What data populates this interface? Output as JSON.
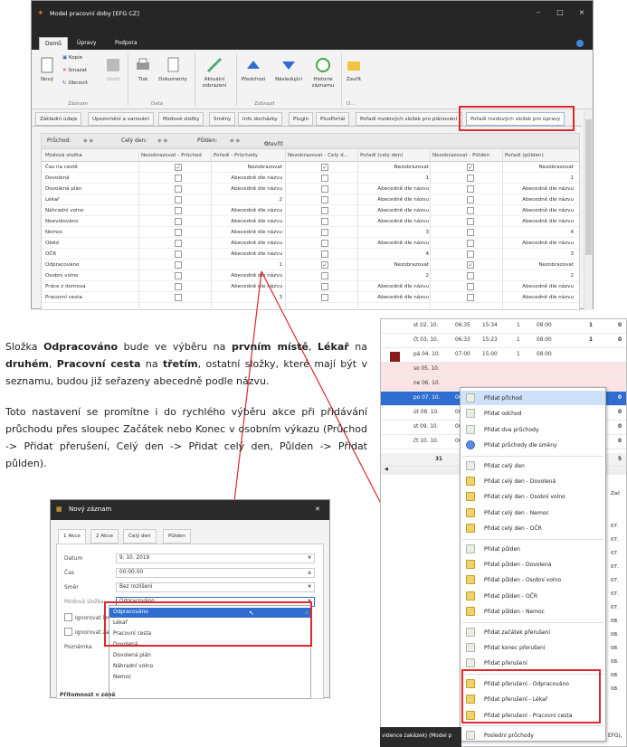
{
  "window": {
    "title": "Model pracovní doby [EFG CZ]",
    "controls": [
      "–",
      "□",
      "×"
    ]
  },
  "ribbon_tabs": [
    "Domů",
    "Úpravy",
    "Podpora"
  ],
  "ribbon": {
    "buttons": {
      "new": "Nový",
      "copy": "Kopie",
      "delete": "Smazat",
      "refresh": "Obnovit",
      "save": "Uložit",
      "print": "Tisk",
      "documents": "Dokumenty",
      "current_view": "Aktuální zobrazení",
      "previous": "Předchozí",
      "next": "Následující",
      "history": "Historie záznamu",
      "close": "Zavřít"
    },
    "groups": [
      "Záznam",
      "Data",
      "Zobrazit",
      "O..."
    ]
  },
  "doc_tabs": [
    "Základní údaje",
    "Upozornění a varování",
    "Mzdové složky",
    "Směny",
    "Info docházky",
    "Plugin",
    "PlusPortál",
    "Pořadí mzdových složek pro plánování",
    "Pořadí mzdových složek pro úpravy"
  ],
  "filter": {
    "pruchod": "Průchod:",
    "cely_den": "Celý den:",
    "pulden": "Půlden:",
    "otevrit": "Otevřít"
  },
  "grid": {
    "headers": [
      "Mzdová složka",
      "Nezobrazovat - Průchod",
      "Pořadí - Průchody",
      "Nezobrazovat - Celý d...",
      "Pořadí (celý den)",
      "Nezobrazovat - Půlden",
      "Pořadí (půlden)"
    ],
    "rows": [
      {
        "name": "Čas na cestě",
        "c1": true,
        "p1": "Nezobrazovat",
        "c2": true,
        "p2": "Nezobrazovat",
        "c3": true,
        "p3": "Nezobrazovat"
      },
      {
        "name": "Dovolená",
        "c1": false,
        "p1": "Abecedně dle názvu",
        "c2": false,
        "p2": "1",
        "c3": false,
        "p3": "1"
      },
      {
        "name": "Dovolená plán",
        "c1": false,
        "p1": "Abecedně dle názvu",
        "c2": false,
        "p2": "Abecedně dle názvu",
        "c3": false,
        "p3": "Abecedně dle názvu"
      },
      {
        "name": "Lékař",
        "c1": false,
        "p1": "2",
        "c2": false,
        "p2": "Abecedně dle názvu",
        "c3": false,
        "p3": "Abecedně dle názvu"
      },
      {
        "name": "Náhradní volno",
        "c1": false,
        "p1": "Abecedně dle názvu",
        "c2": false,
        "p2": "Abecedně dle názvu",
        "c3": false,
        "p3": "Abecedně dle názvu"
      },
      {
        "name": "Neevidováno",
        "c1": false,
        "p1": "Abecedně dle názvu",
        "c2": false,
        "p2": "Abecedně dle názvu",
        "c3": false,
        "p3": "Abecedně dle názvu"
      },
      {
        "name": "Nemoc",
        "c1": false,
        "p1": "Abecedně dle názvu",
        "c2": false,
        "p2": "3",
        "c3": false,
        "p3": "4"
      },
      {
        "name": "Oběd",
        "c1": false,
        "p1": "Abecedně dle názvu",
        "c2": false,
        "p2": "Abecedně dle názvu",
        "c3": false,
        "p3": "Abecedně dle názvu"
      },
      {
        "name": "OČR",
        "c1": false,
        "p1": "Abecedně dle názvu",
        "c2": false,
        "p2": "4",
        "c3": false,
        "p3": "3"
      },
      {
        "name": "Odpracováno",
        "c1": false,
        "p1": "1",
        "c2": true,
        "p2": "Nezobrazovat",
        "c3": true,
        "p3": "Nezobrazovat"
      },
      {
        "name": "Osobní volno",
        "c1": false,
        "p1": "Abecedně dle názvu",
        "c2": false,
        "p2": "2",
        "c3": false,
        "p3": "2"
      },
      {
        "name": "Práce z domova",
        "c1": false,
        "p1": "Abecedně dle názvu",
        "c2": false,
        "p2": "Abecedně dle názvu",
        "c3": false,
        "p3": "Abecedně dle názvu"
      },
      {
        "name": "Pracovní cesta",
        "c1": false,
        "p1": "3",
        "c2": false,
        "p2": "Abecedně dle názvu",
        "c3": false,
        "p3": "Abecedně dle názvu"
      }
    ]
  },
  "text": {
    "p1_a": "Složka ",
    "p1_b": "Odpracováno",
    "p1_c": " bude ve výběru na ",
    "p1_d": "prvním místě",
    "p1_e": ", ",
    "p1_f": "Lékař",
    "p1_g": " na ",
    "p1_h": "druhém",
    "p1_i": ", ",
    "p1_j": "Pracovní cesta",
    "p1_k": " na ",
    "p1_l": "třetím",
    "p1_m": ", ostatní složky, které mají být v seznamu, budou již seřazeny abecedně podle názvu.",
    "p2": "Toto nastavení se promítne i do rychlého výběru akce při přidávání průchodu přes sloupec Začátek nebo Konec v osobním výkazu (Průchod -> Přidat přerušení, Celý den -> Přidat celý den, Půlden -> Přidat půlden)."
  },
  "dialog": {
    "title": "Nový záznam",
    "tabs": [
      "1 Akce",
      "2 Akce",
      "Celý den",
      "Půlden"
    ],
    "fields": {
      "datum_label": "Datum",
      "datum": "9. 10. 2019",
      "cas_label": "Čas",
      "cas": "00:00:00",
      "smer_label": "Směr",
      "smer": "Bez rozlišení",
      "mzdova_label": "Mzdová složka",
      "mzdova": "Odpracováno",
      "ign1": "Ignorovat lim",
      "ign2": "Ignorovat za",
      "poznamka": "Poznámka"
    },
    "dropdown": [
      "Odpracováno",
      "Lékař",
      "Pracovní cesta",
      "Dovolená",
      "Dovolená plán",
      "Náhradní volno",
      "Nemoc"
    ],
    "footer": "Přítomnost v zóně"
  },
  "calendar": {
    "rows": [
      {
        "day": "st 02. 10.",
        "a": "06:35",
        "b": "15:34",
        "c": "1",
        "d": "08:00",
        "e": "1",
        "f": "0"
      },
      {
        "day": "čt 03. 10.",
        "a": "06:33",
        "b": "15:23",
        "c": "1",
        "d": "08:00",
        "e": "1",
        "f": "0"
      },
      {
        "day": "pá 04. 10.",
        "a": "07:00",
        "b": "15:00",
        "c": "1",
        "d": "08:00",
        "e": "",
        "f": ""
      },
      {
        "day": "so 05. 10.",
        "a": "",
        "b": "",
        "c": "",
        "d": "",
        "e": "",
        "f": ""
      },
      {
        "day": "ne 06. 10.",
        "a": "",
        "b": "",
        "c": "",
        "d": "",
        "e": "",
        "f": ""
      },
      {
        "day": "po 07. 10.",
        "a": "06",
        "b": "",
        "c": "",
        "d": "",
        "e": "",
        "f": "0"
      },
      {
        "day": "út 08. 10.",
        "a": "06",
        "b": "",
        "c": "",
        "d": "",
        "e": "",
        "f": "0"
      },
      {
        "day": "st 09. 10.",
        "a": "06",
        "b": "",
        "c": "",
        "d": "",
        "e": "",
        "f": "0"
      },
      {
        "day": "čt 10. 10.",
        "a": "06",
        "b": "",
        "c": "",
        "d": "",
        "e": "",
        "f": "0"
      }
    ],
    "total": "31",
    "total_right": "5",
    "zac": "Zač",
    "side": [
      "07.",
      "07.",
      "07.",
      "07.",
      "07.",
      "07.",
      "07.",
      "08.",
      "08.",
      "08.",
      "08.",
      "08.",
      "08."
    ],
    "bottom": "vidence zakázek) (Model p",
    "bottom_right": "EFG),"
  },
  "context_menu": [
    "Přidat příchod",
    "Přidat odchod",
    "Přidat dva průchody",
    "Přidat průchody dle směny",
    "Přidat celý den",
    "Přidat celý den - Dovolená",
    "Přidat celý den - Osobní volno",
    "Přidat celý den - Nemoc",
    "Přidat celý den - OČR",
    "Přidat půlden",
    "Přidat půlden - Dovolená",
    "Přidat půlden - Osobní volno",
    "Přidat půlden - OČR",
    "Přidat půlden - Nemoc",
    "Přidat začátek přerušení",
    "Přidat konec přerušení",
    "Přidat přerušení",
    "Přidat přerušení - Odpracováno",
    "Přidat přerušení - Lékař",
    "Přidat přerušení - Pracovní cesta",
    "Poslední průchody"
  ],
  "accent": "#e0282f",
  "select_blue": "#2f6ed0"
}
